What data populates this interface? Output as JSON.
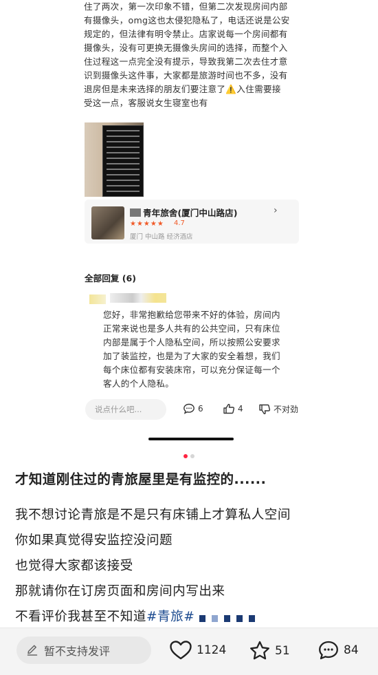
{
  "review": {
    "lines": [
      "住了两次，第一次印象不错，但第二次发现房间内部",
      "有摄像头，omg这也太侵犯隐私了，电话还说是公安",
      "规定的，但法律有明令禁止。店家说每一个房间都有",
      "摄像头，没有可更换无摄像头房间的选择，而整个入",
      "住过程这一点完全没有提示，导致我第二次去住才意",
      "识到摄像头这件事，大家都是旅游时间也不多，没有",
      "退房但是未来选择的朋友们要注意了⚠️入住需要接",
      "受这一点，客服说女生寝室也有"
    ]
  },
  "hotel": {
    "name": "青年旅舍(厦门中山路店)",
    "rating": "4.7",
    "stars": "★★★★★",
    "location": "厦门 中山路 经济酒店"
  },
  "replies": {
    "header": "全部回复 (6)",
    "lines": [
      "您好，非常抱歉给您带来不好的体验，房间内",
      "正常来说也是多人共有的公共空间，只有床位",
      "内部是属于个人隐私空间，所以按照公安要求",
      "加了装监控，也是为了大家的安全着想，我们",
      "每个床位都有安装床帘，可以充分保证每一个",
      "客人的个人隐私。"
    ],
    "input_placeholder": "说点什么吧...",
    "comments_count": "6",
    "likes_count": "4",
    "dislike_label": "不对劲"
  },
  "post": {
    "title": "才知道刚住过的青旅屋里是有监控的......",
    "lines": [
      "我不想讨论青旅是不是只有床铺上才算私人空间",
      "你如果真觉得安监控没问题",
      "也觉得大家都该接受",
      "那就请你在订房页面和房间内写出来"
    ],
    "last_line_prefix": "不看评价我甚至不知道",
    "hashtag": "#青旅#"
  },
  "bottom_bar": {
    "comment_placeholder": "暂不支持发评",
    "likes": "1124",
    "favorites": "51",
    "comments": "84"
  },
  "colors": {
    "accent": "#ff2442",
    "rating_orange": "#f05a28",
    "hashtag_blue": "#1b4a8f"
  }
}
